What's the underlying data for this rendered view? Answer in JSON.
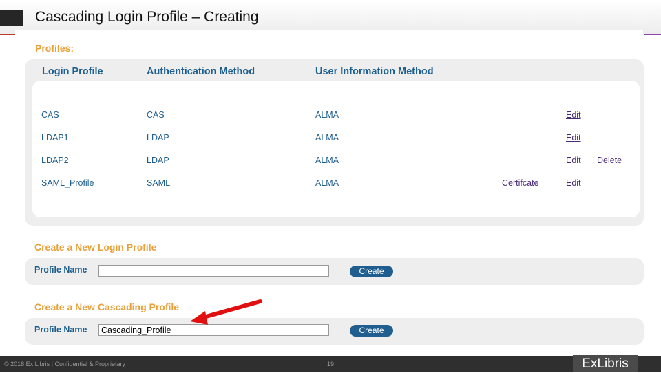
{
  "title": "Cascading Login Profile – Creating",
  "profiles": {
    "label": "Profiles:",
    "headers": [
      "Login Profile",
      "Authentication Method",
      "User Information Method"
    ],
    "rows": [
      {
        "name": "CAS",
        "auth": "CAS",
        "info": "ALMA",
        "cert": "",
        "edit": "Edit",
        "del": ""
      },
      {
        "name": "LDAP1",
        "auth": "LDAP",
        "info": "ALMA",
        "cert": "",
        "edit": "Edit",
        "del": ""
      },
      {
        "name": "LDAP2",
        "auth": "LDAP",
        "info": "ALMA",
        "cert": "",
        "edit": "Edit",
        "del": "Delete"
      },
      {
        "name": "SAML_Profile",
        "auth": "SAML",
        "info": "ALMA",
        "cert": "Certifcate",
        "edit": "Edit",
        "del": ""
      }
    ]
  },
  "create_login": {
    "heading": "Create a New Login Profile",
    "label": "Profile Name",
    "value": "",
    "button": "Create"
  },
  "create_cascading": {
    "heading": "Create a New Cascading Profile",
    "label": "Profile Name",
    "value": "Cascading_Profile",
    "button": "Create"
  },
  "footer": {
    "copyright": "© 2018 Ex Libris | Confidential & Proprietary",
    "page": "19",
    "logo": "ExLibris"
  }
}
